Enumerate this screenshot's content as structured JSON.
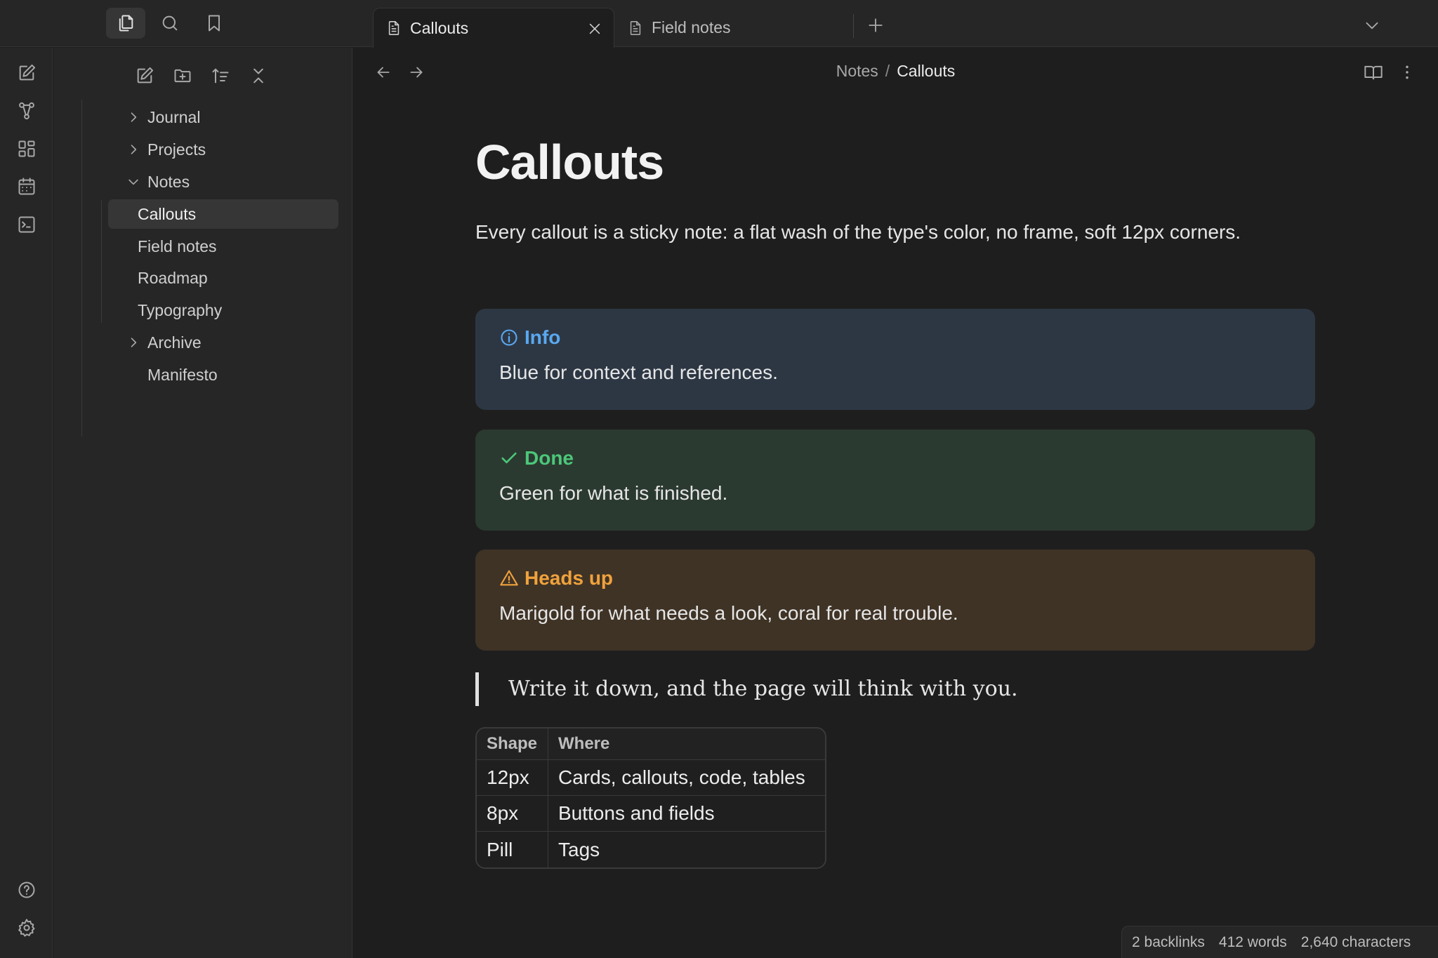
{
  "tabs": [
    {
      "label": "Callouts",
      "active": true
    },
    {
      "label": "Field notes",
      "active": false
    }
  ],
  "sidebar": {
    "tree": [
      {
        "label": "Journal",
        "type": "folder",
        "expanded": false
      },
      {
        "label": "Projects",
        "type": "folder",
        "expanded": false
      },
      {
        "label": "Notes",
        "type": "folder",
        "expanded": true,
        "children": [
          {
            "label": "Callouts",
            "selected": true
          },
          {
            "label": "Field notes"
          },
          {
            "label": "Roadmap"
          },
          {
            "label": "Typography"
          }
        ]
      },
      {
        "label": "Archive",
        "type": "folder",
        "expanded": false
      },
      {
        "label": "Manifesto",
        "type": "file"
      }
    ]
  },
  "breadcrumb": {
    "parent": "Notes",
    "separator": "/",
    "current": "Callouts"
  },
  "page": {
    "title": "Callouts",
    "intro": "Every callout is a sticky note: a flat wash of the type's color, no frame, soft 12px corners.",
    "callouts": [
      {
        "title": "Info",
        "body": "Blue for context and references.",
        "icon": "info-icon",
        "title_color": "#5aa8f0",
        "bg": "#2d3744"
      },
      {
        "title": "Done",
        "body": "Green for what is finished.",
        "icon": "check-icon",
        "title_color": "#4cc77a",
        "bg": "#2b3a30"
      },
      {
        "title": "Heads up",
        "body": "Marigold for what needs a look, coral for real trouble.",
        "icon": "warning-icon",
        "title_color": "#f0a23c",
        "bg": "#3f3326"
      }
    ],
    "quote": "Write it down, and the page will think with you.",
    "table": {
      "headers": [
        "Shape",
        "Where"
      ],
      "rows": [
        [
          "12px",
          "Cards, callouts, code, tables"
        ],
        [
          "8px",
          "Buttons and fields"
        ],
        [
          "Pill",
          "Tags"
        ]
      ]
    }
  },
  "status": {
    "backlinks": "2 backlinks",
    "words": "412 words",
    "characters": "2,640 characters"
  }
}
